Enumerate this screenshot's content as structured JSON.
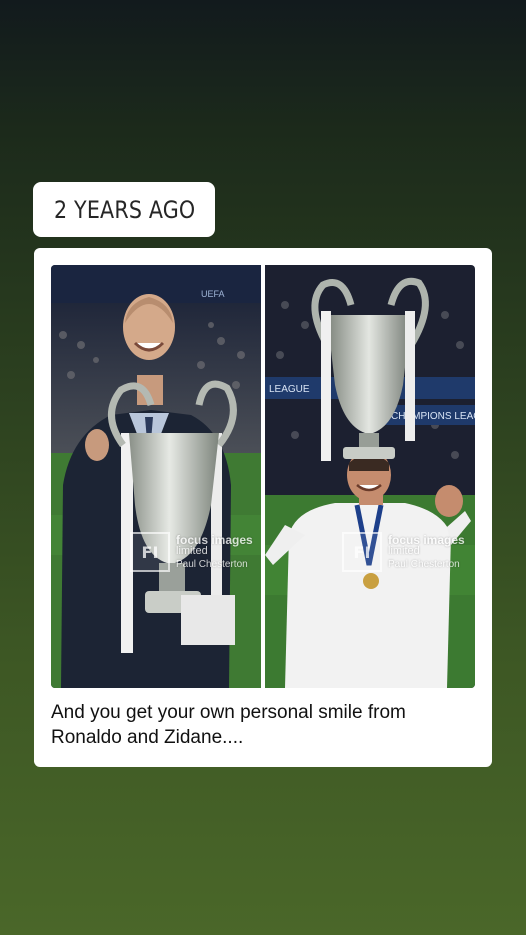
{
  "memory_sticker": {
    "icon": "history-clock-icon",
    "label": "2 YEARS AGO"
  },
  "post": {
    "caption": "And you get your own personal smile from Ronaldo and Zidane....",
    "photos": [
      {
        "watermark_brand": "focus images",
        "watermark_sub": "limited",
        "watermark_author": "Paul Chesterton"
      },
      {
        "watermark_brand": "focus images",
        "watermark_sub": "limited",
        "watermark_author": "Paul Chesterton"
      }
    ],
    "stadium_boards": [
      "UEFA CHAMPIONS LEAGUE",
      "CHAMPIONS LEAGUE",
      "CHAMPIONS LEAGUE"
    ]
  },
  "colors": {
    "background_top": "#121a1d",
    "background_bottom": "#4a6729",
    "card": "#ffffff",
    "sticker_icon": "#2f6db5",
    "pitch": "#3d7a32"
  }
}
